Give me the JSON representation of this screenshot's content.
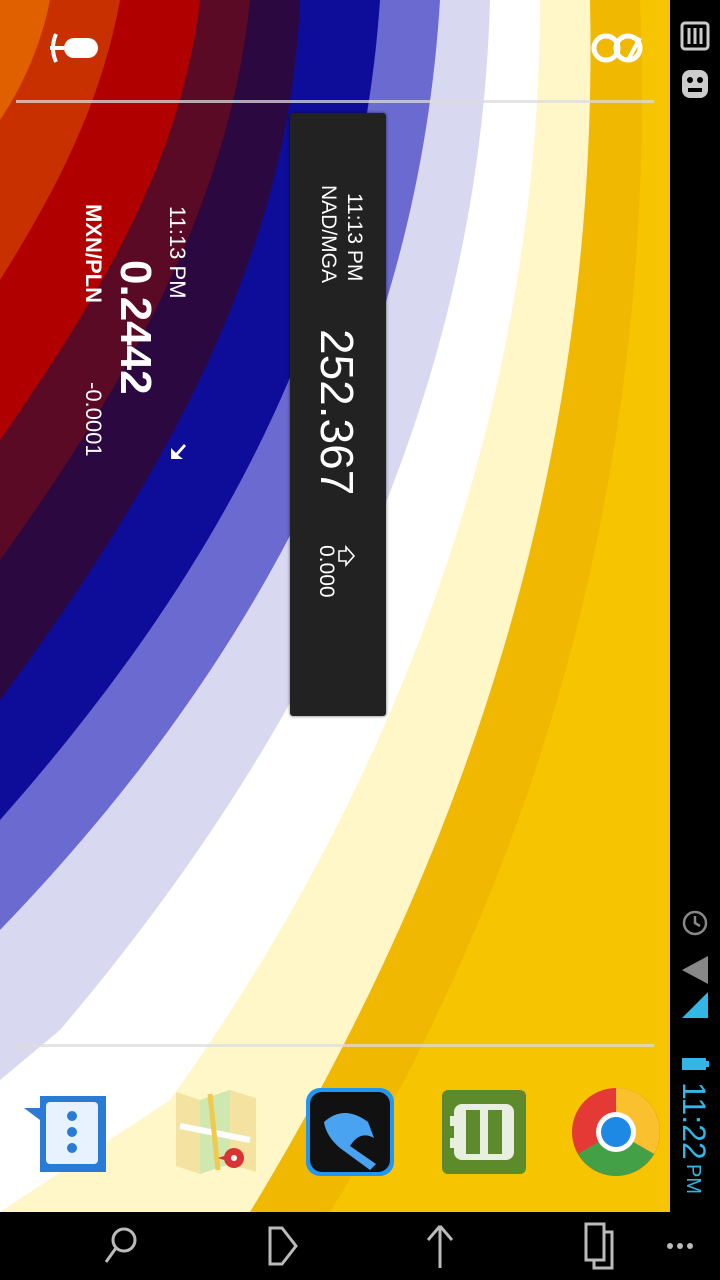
{
  "status_bar": {
    "time": "11:22",
    "ampm": "PM",
    "battery": "48",
    "icons": [
      "notification-card-icon",
      "android-robot-icon",
      "alarm-clock-icon",
      "wifi-icon",
      "signal-icon",
      "battery-charging-icon"
    ],
    "accent": "#33b5e5"
  },
  "search_bar": {
    "icons": [
      "google-search-icon",
      "voice-search-icon"
    ]
  },
  "widget_white": {
    "time": "11:13 PM",
    "rate": "0.2442",
    "pair": "MXN/PLN",
    "change": "-0.0001",
    "direction_icon": "arrow-down-left-icon"
  },
  "widget_card": {
    "time": "11:13 PM",
    "pair": "NAD/MGA",
    "rate": "252.367",
    "change": "0.000",
    "direction_icon": "arrow-down-outline-icon"
  },
  "dock": {
    "apps": [
      "messaging",
      "maps",
      "phone",
      "bus-transit",
      "chrome"
    ]
  },
  "nav_bar": {
    "buttons": [
      "search-icon",
      "back-icon",
      "home-icon",
      "recents-icon",
      "menu-icon"
    ]
  }
}
